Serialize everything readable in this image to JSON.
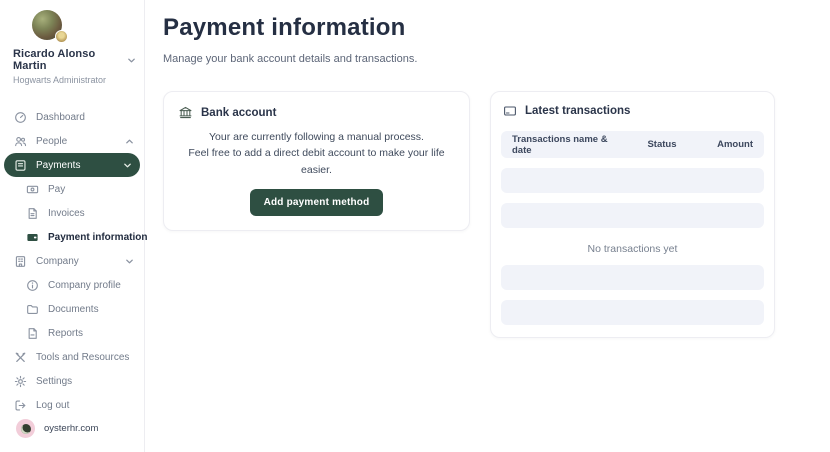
{
  "user": {
    "name": "Ricardo Alonso Martin",
    "role": "Hogwarts Administrator"
  },
  "sidebar": {
    "items": [
      {
        "label": "Dashboard"
      },
      {
        "label": "People"
      },
      {
        "label": "Payments"
      },
      {
        "label": "Pay"
      },
      {
        "label": "Invoices"
      },
      {
        "label": "Payment information"
      },
      {
        "label": "Company"
      },
      {
        "label": "Company profile"
      },
      {
        "label": "Documents"
      },
      {
        "label": "Reports"
      },
      {
        "label": "Tools and Resources"
      },
      {
        "label": "Settings"
      },
      {
        "label": "Log out"
      }
    ],
    "footer": {
      "brand": "oysterhr.com"
    }
  },
  "header": {
    "title": "Payment information",
    "subtitle": "Manage your bank account details and transactions."
  },
  "bank_card": {
    "title": "Bank account",
    "line1": "Your are currently following a manual process.",
    "line2": "Feel free to add a direct debit account to make your life easier.",
    "button_label": "Add payment method"
  },
  "transactions_card": {
    "title": "Latest transactions",
    "columns": [
      "Transactions name & date",
      "Status",
      "Amount"
    ],
    "empty_text": "No transactions yet",
    "placeholder_row_count": 4
  },
  "icons": {
    "sidebar": [
      "dashboard-icon",
      "people-icon",
      "payments-icon",
      "pay-icon",
      "invoices-icon",
      "wallet-icon",
      "company-icon",
      "info-icon",
      "folder-icon",
      "report-icon",
      "tools-icon",
      "gear-icon",
      "logout-icon"
    ],
    "cards": [
      "bank-icon",
      "transactions-icon"
    ]
  },
  "colors": {
    "accent_green": "#2e4f42",
    "row_bg": "#f1f3f9",
    "title_navy": "#252f43",
    "muted_text": "#727b8a",
    "brand_pink": "#f2cdd9"
  }
}
